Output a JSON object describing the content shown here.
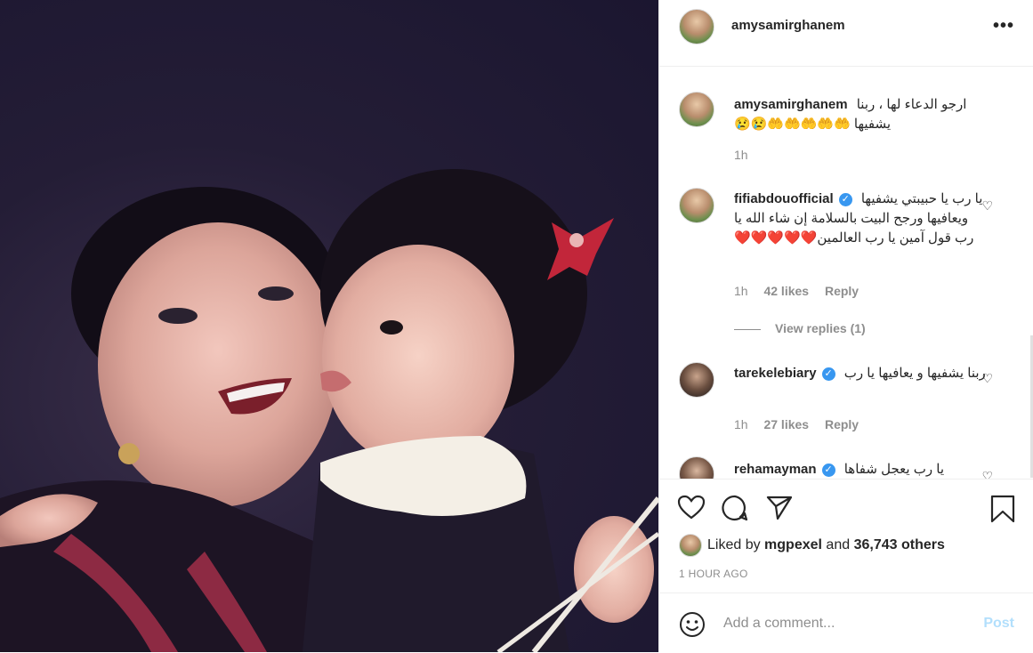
{
  "post": {
    "username": "amysamirghanem",
    "more_label": "•••",
    "caption": {
      "username": "amysamirghanem",
      "text": "ارجو الدعاء لها ، ربنا يشفيها 🤲🤲🤲🤲🤲😢😢",
      "time": "1h"
    },
    "comments": [
      {
        "username": "fifiabdouofficial",
        "verified": true,
        "text": "يا رب يا حبيبتي يشفيها ويعافيها ورجح البيت بالسلامة إن شاء الله يا رب قول آمين يا رب العالمين❤️❤️❤️❤️❤️",
        "time": "1h",
        "likes": "42 likes",
        "reply": "Reply",
        "view_replies": "View replies (1)"
      },
      {
        "username": "tarekelebiary",
        "verified": true,
        "text": "ربنا يشفيها و يعافيها يا رب",
        "time": "1h",
        "likes": "27 likes",
        "reply": "Reply"
      },
      {
        "username": "rehamayman",
        "verified": true,
        "text": "يا رب يعجل شفاها"
      }
    ],
    "likes": {
      "liked_by": "mgpexel",
      "prefix": "Liked by",
      "middle": "and",
      "others": "36,743 others"
    },
    "timestamp": "1 HOUR AGO",
    "add_comment_placeholder": "Add a comment...",
    "post_button": "Post",
    "colors": {
      "link_blue": "#3897f0",
      "post_disabled": "#b2dffc",
      "muted": "#8e8e8e"
    }
  }
}
